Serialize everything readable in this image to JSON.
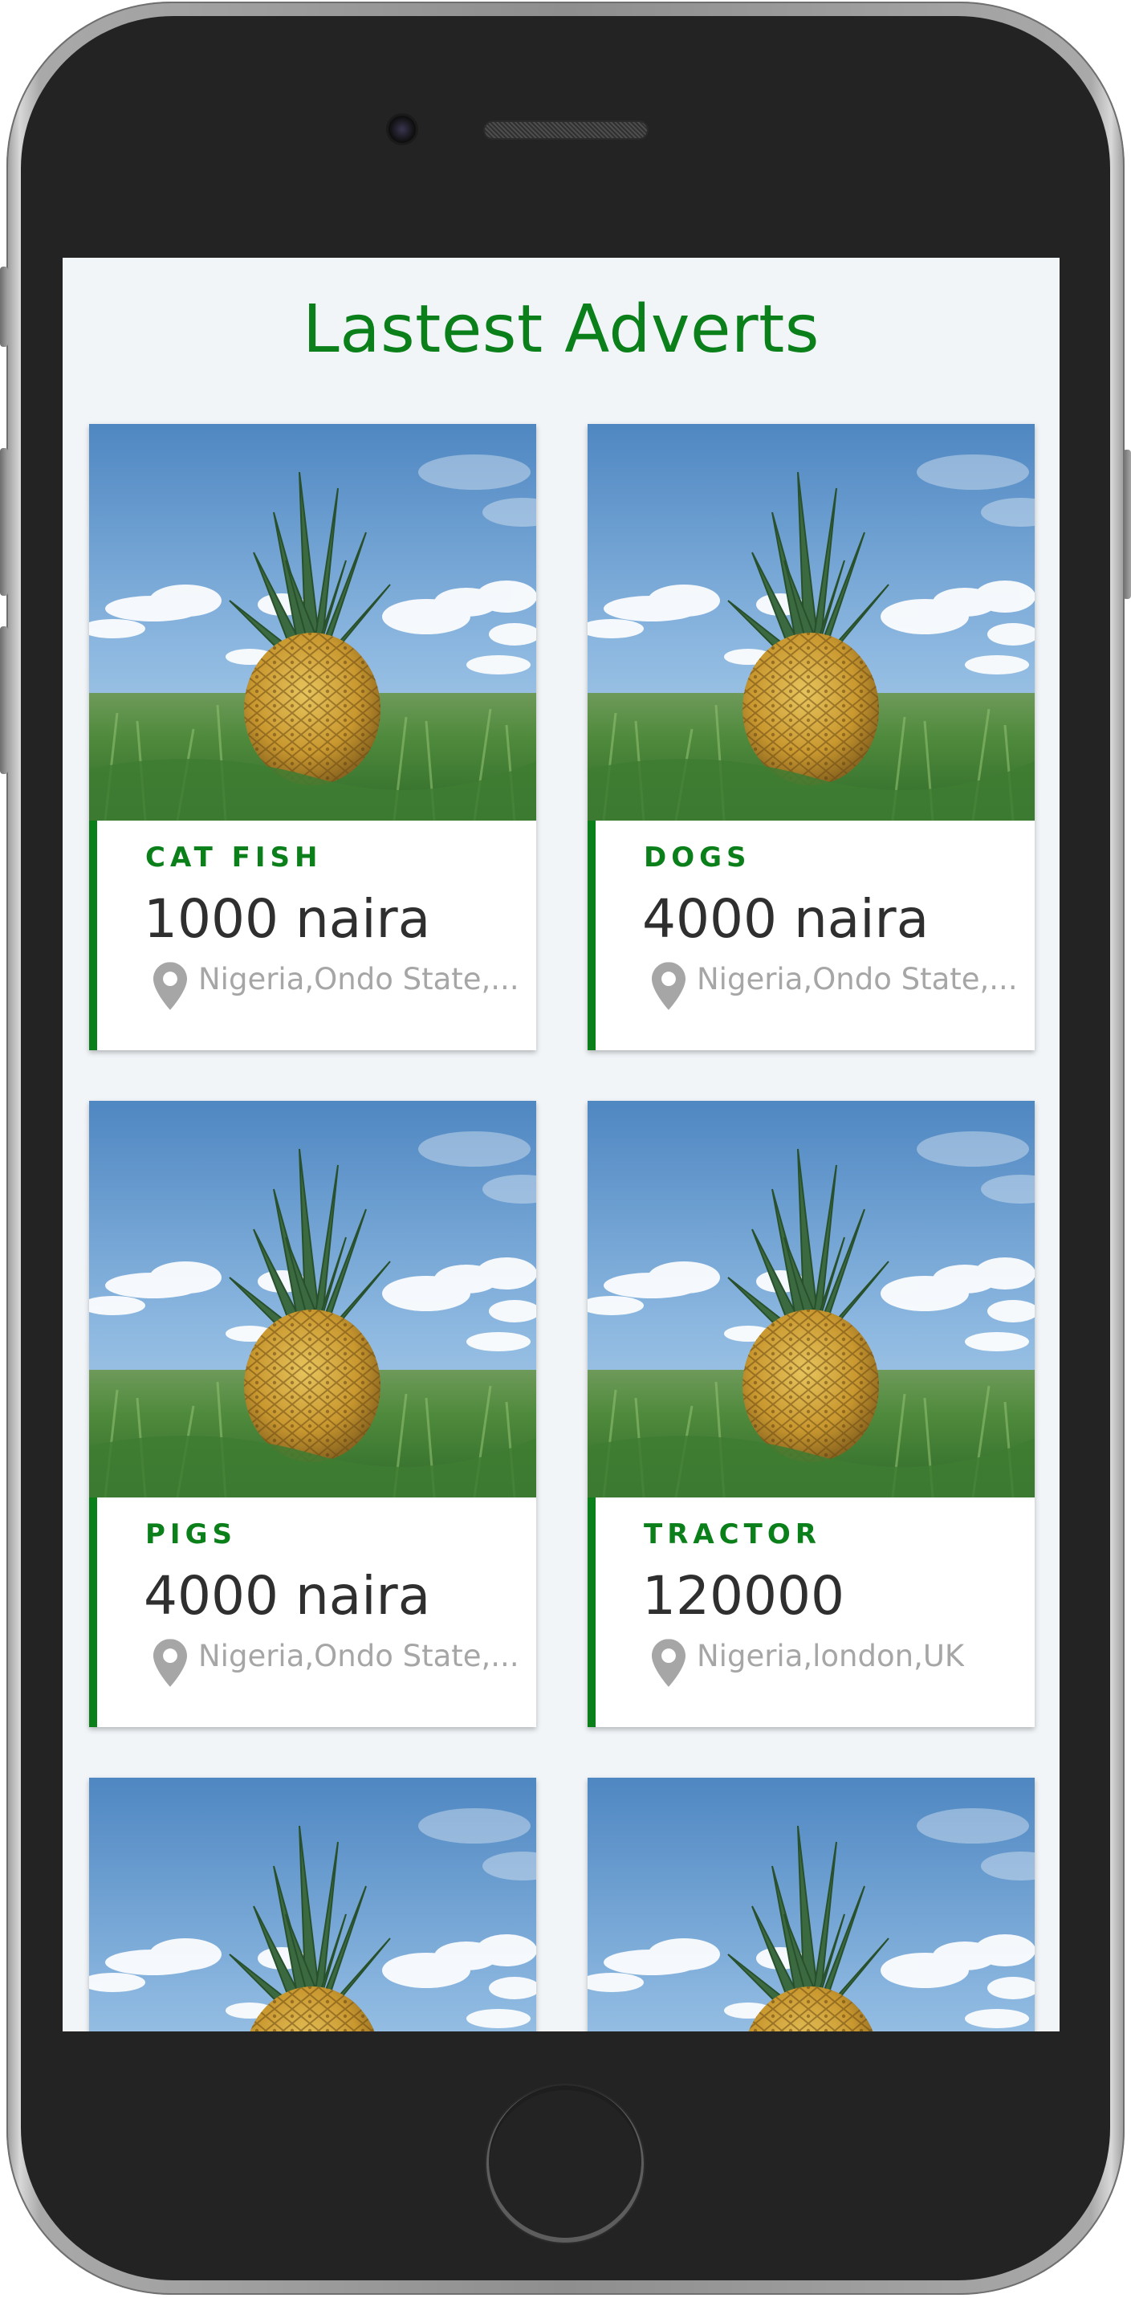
{
  "page": {
    "title": "Lastest Adverts"
  },
  "colors": {
    "accent": "#0a7f1a",
    "screen_background": "#f1f5f8",
    "price_text": "#2f2f2f",
    "location_text": "#a6a6a6"
  },
  "adverts": [
    {
      "category": "CAT FISH",
      "price": "1000 naira",
      "location": "Nigeria,Ondo State,...",
      "image": "pineapple-photo"
    },
    {
      "category": "DOGS",
      "price": "4000 naira",
      "location": "Nigeria,Ondo State,...",
      "image": "pineapple-photo"
    },
    {
      "category": "PIGS",
      "price": "4000 naira",
      "location": "Nigeria,Ondo State,...",
      "image": "pineapple-photo"
    },
    {
      "category": "TRACTOR",
      "price": "120000",
      "location": "Nigeria,london,UK",
      "image": "pineapple-photo"
    },
    {
      "image": "pineapple-photo"
    },
    {
      "image": "pineapple-photo"
    }
  ]
}
